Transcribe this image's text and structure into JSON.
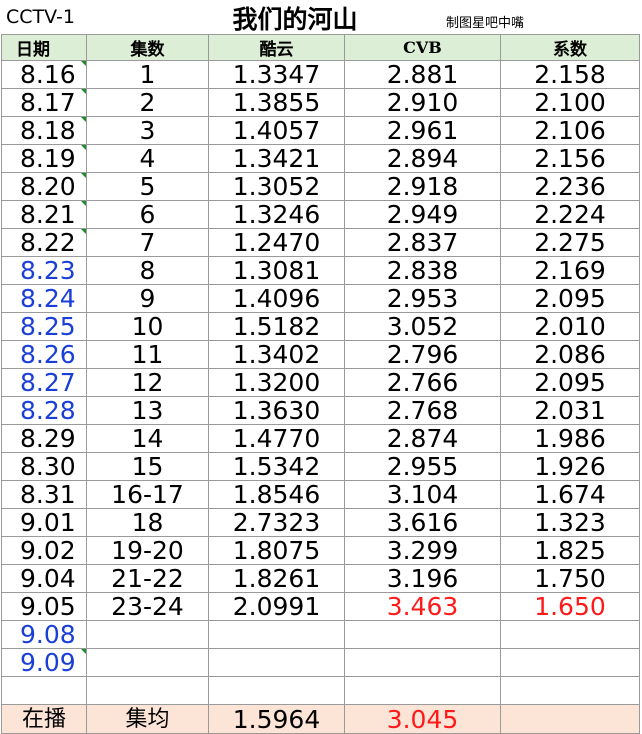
{
  "header": {
    "channel": "CCTV-1",
    "title": "我们的河山",
    "credit": "制图星吧中嘴"
  },
  "columns": [
    "日期",
    "集数",
    "酷云",
    "CVB",
    "系数"
  ],
  "rows": [
    {
      "date": "8.16",
      "ep": "1",
      "kuyun": "1.3347",
      "cvb": "2.881",
      "coef": "2.158",
      "date_color": "black"
    },
    {
      "date": "8.17",
      "ep": "2",
      "kuyun": "1.3855",
      "cvb": "2.910",
      "coef": "2.100",
      "date_color": "black"
    },
    {
      "date": "8.18",
      "ep": "3",
      "kuyun": "1.4057",
      "cvb": "2.961",
      "coef": "2.106",
      "date_color": "black"
    },
    {
      "date": "8.19",
      "ep": "4",
      "kuyun": "1.3421",
      "cvb": "2.894",
      "coef": "2.156",
      "date_color": "black"
    },
    {
      "date": "8.20",
      "ep": "5",
      "kuyun": "1.3052",
      "cvb": "2.918",
      "coef": "2.236",
      "date_color": "black"
    },
    {
      "date": "8.21",
      "ep": "6",
      "kuyun": "1.3246",
      "cvb": "2.949",
      "coef": "2.224",
      "date_color": "black"
    },
    {
      "date": "8.22",
      "ep": "7",
      "kuyun": "1.2470",
      "cvb": "2.837",
      "coef": "2.275",
      "date_color": "black"
    },
    {
      "date": "8.23",
      "ep": "8",
      "kuyun": "1.3081",
      "cvb": "2.838",
      "coef": "2.169",
      "date_color": "blue"
    },
    {
      "date": "8.24",
      "ep": "9",
      "kuyun": "1.4096",
      "cvb": "2.953",
      "coef": "2.095",
      "date_color": "blue"
    },
    {
      "date": "8.25",
      "ep": "10",
      "kuyun": "1.5182",
      "cvb": "3.052",
      "coef": "2.010",
      "date_color": "blue"
    },
    {
      "date": "8.26",
      "ep": "11",
      "kuyun": "1.3402",
      "cvb": "2.796",
      "coef": "2.086",
      "date_color": "blue"
    },
    {
      "date": "8.27",
      "ep": "12",
      "kuyun": "1.3200",
      "cvb": "2.766",
      "coef": "2.095",
      "date_color": "blue"
    },
    {
      "date": "8.28",
      "ep": "13",
      "kuyun": "1.3630",
      "cvb": "2.768",
      "coef": "2.031",
      "date_color": "blue"
    },
    {
      "date": "8.29",
      "ep": "14",
      "kuyun": "1.4770",
      "cvb": "2.874",
      "coef": "1.986",
      "date_color": "black"
    },
    {
      "date": "8.30",
      "ep": "15",
      "kuyun": "1.5342",
      "cvb": "2.955",
      "coef": "1.926",
      "date_color": "black"
    },
    {
      "date": "8.31",
      "ep": "16-17",
      "kuyun": "1.8546",
      "cvb": "3.104",
      "coef": "1.674",
      "date_color": "black"
    },
    {
      "date": "9.01",
      "ep": "18",
      "kuyun": "2.7323",
      "cvb": "3.616",
      "coef": "1.323",
      "date_color": "black"
    },
    {
      "date": "9.02",
      "ep": "19-20",
      "kuyun": "1.8075",
      "cvb": "3.299",
      "coef": "1.825",
      "date_color": "black"
    },
    {
      "date": "9.04",
      "ep": "21-22",
      "kuyun": "1.8261",
      "cvb": "3.196",
      "coef": "1.750",
      "date_color": "black"
    },
    {
      "date": "9.05",
      "ep": "23-24",
      "kuyun": "2.0991",
      "cvb": "3.463",
      "coef": "1.650",
      "date_color": "black",
      "highlight": true
    },
    {
      "date": "9.08",
      "ep": "",
      "kuyun": "",
      "cvb": "",
      "coef": "",
      "date_color": "blue"
    },
    {
      "date": "9.09",
      "ep": "",
      "kuyun": "",
      "cvb": "",
      "coef": "",
      "date_color": "blue"
    }
  ],
  "summary": {
    "label1": "在播",
    "label2": "集均",
    "kuyun": "1.5964",
    "cvb": "3.045"
  },
  "colors": {
    "header_bg": "#dcefd6",
    "summary_bg": "#fce4d6",
    "blue_text": "#1a3fd6",
    "red_text": "#ff1a1a",
    "marker_green": "#1e8a2a"
  }
}
